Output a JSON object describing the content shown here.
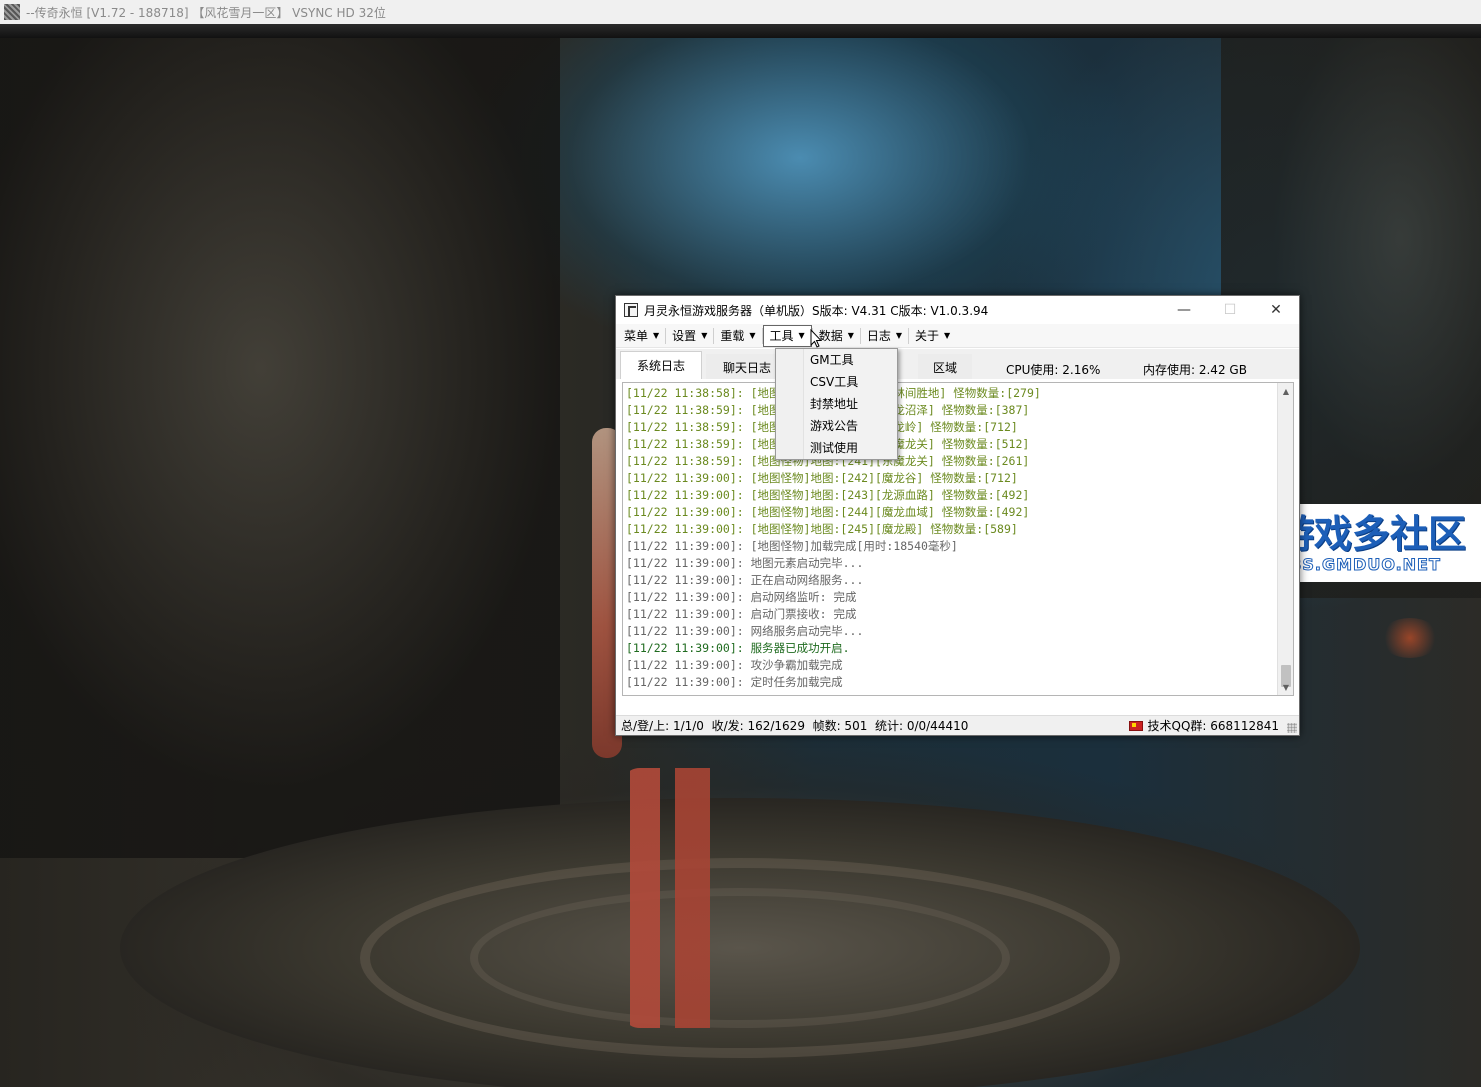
{
  "game_window": {
    "title": "--传奇永恒 [V1.72 - 188718] 【风花雪月一区】 VSYNC HD 32位"
  },
  "watermark": {
    "title": "游戏多社区",
    "subtitle": "BBS.GMDUO.NET"
  },
  "server_window": {
    "title": "月灵永恒游戏服务器（单机版）S版本: V4.31 C版本: V1.0.3.94",
    "controls": {
      "minimize": "—",
      "maximize": "☐",
      "close": "✕"
    },
    "menu": [
      {
        "label": "菜单"
      },
      {
        "label": "设置"
      },
      {
        "label": "重载"
      },
      {
        "label": "工具"
      },
      {
        "label": "数据"
      },
      {
        "label": "日志"
      },
      {
        "label": "关于"
      }
    ],
    "tabs": [
      {
        "label": "系统日志"
      },
      {
        "label": "聊天日志"
      },
      {
        "label": "区域"
      }
    ],
    "cpu": "CPU使用: 2.16%",
    "memory": "内存使用: 2.42 GB",
    "log_lines": [
      {
        "text": "[11/22 11:38:58]: [地图怪物]地图:[237][树林间胜地] 怪物数量:[279]",
        "color": "olive"
      },
      {
        "text": "[11/22 11:38:59]: [地图怪物]地图:[238][魔龙沼泽] 怪物数量:[387]",
        "color": "olive"
      },
      {
        "text": "[11/22 11:38:59]: [地图怪物]地图:[239][魔龙岭] 怪物数量:[712]",
        "color": "olive"
      },
      {
        "text": "[11/22 11:38:59]: [地图怪物]地图:[240][西魔龙关] 怪物数量:[512]",
        "color": "olive"
      },
      {
        "text": "[11/22 11:38:59]: [地图怪物]地图:[241][东魔龙关] 怪物数量:[261]",
        "color": "olive"
      },
      {
        "text": "[11/22 11:39:00]: [地图怪物]地图:[242][魔龙谷] 怪物数量:[712]",
        "color": "olive"
      },
      {
        "text": "[11/22 11:39:00]: [地图怪物]地图:[243][龙源血路] 怪物数量:[492]",
        "color": "olive"
      },
      {
        "text": "[11/22 11:39:00]: [地图怪物]地图:[244][魔龙血域] 怪物数量:[492]",
        "color": "olive"
      },
      {
        "text": "[11/22 11:39:00]: [地图怪物]地图:[245][魔龙殿] 怪物数量:[589]",
        "color": "olive"
      },
      {
        "text": "[11/22 11:39:00]: [地图怪物]加载完成[用时:18540毫秒]",
        "color": "gray"
      },
      {
        "text": "[11/22 11:39:00]: 地图元素启动完毕...",
        "color": "gray"
      },
      {
        "text": "[11/22 11:39:00]: 正在启动网络服务...",
        "color": "gray"
      },
      {
        "text": "[11/22 11:39:00]: 启动网络监听: 完成",
        "color": "gray"
      },
      {
        "text": "[11/22 11:39:00]: 启动门票接收: 完成",
        "color": "gray"
      },
      {
        "text": "[11/22 11:39:00]: 网络服务启动完毕...",
        "color": "gray"
      },
      {
        "text": "[11/22 11:39:00]: 服务器已成功开启.",
        "color": "green"
      },
      {
        "text": "[11/22 11:39:00]: 攻沙争霸加载完成",
        "color": "gray"
      },
      {
        "text": "[11/22 11:39:00]: 定时任务加载完成",
        "color": "gray"
      }
    ],
    "status_left": "总/登/上: 1/1/0  收/发: 162/1629  帧数: 501  统计: 0/0/44410",
    "status_right": "技术QQ群:  668112841",
    "scroll_arrows": {
      "up": "▲",
      "down": "▼"
    }
  },
  "dropdown": {
    "items": [
      {
        "label": "GM工具"
      },
      {
        "label": "CSV工具"
      },
      {
        "label": "封禁地址"
      },
      {
        "label": "游戏公告"
      },
      {
        "label": "测试使用"
      }
    ]
  },
  "colors": {
    "log_olive": "#6b8a1f",
    "log_gray": "#666666",
    "log_green": "#1f6b1f",
    "watermark_blue": "#1d5fb8"
  }
}
